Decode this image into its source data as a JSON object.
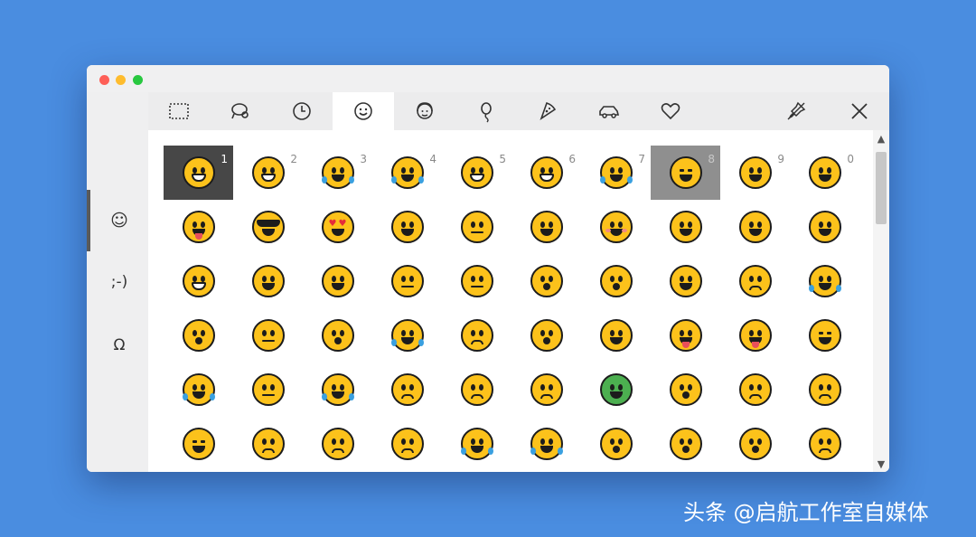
{
  "window": {
    "sidebar": {
      "items": [
        {
          "glyph": "☺",
          "icon": "emoji-face-icon"
        },
        {
          "glyph": ";-)",
          "icon": "kaomoji-icon"
        },
        {
          "glyph": "Ω",
          "icon": "symbols-icon"
        }
      ],
      "selected": 0
    },
    "tabs": [
      {
        "icon": "recent-icon"
      },
      {
        "icon": "people-icon"
      },
      {
        "icon": "clock-icon"
      },
      {
        "icon": "smiley-icon",
        "active": true
      },
      {
        "icon": "person-icon"
      },
      {
        "icon": "balloon-icon"
      },
      {
        "icon": "pizza-icon"
      },
      {
        "icon": "car-icon"
      },
      {
        "icon": "heart-icon"
      }
    ],
    "right_controls": [
      {
        "icon": "pin-icon"
      },
      {
        "icon": "close-icon"
      }
    ],
    "hint_numbers": [
      "1",
      "2",
      "3",
      "4",
      "5",
      "6",
      "7",
      "8",
      "9",
      "0"
    ],
    "emoji_rows": 6,
    "emoji_cols": 10,
    "selected_cells": [
      0,
      7
    ]
  },
  "watermark": "头条 @启航工作室自媒体",
  "colors": {
    "background": "#4a8de0",
    "emoji_yellow": "#fcc21b",
    "selected_dark": "#474747",
    "selected_light": "#8f8f8f"
  }
}
